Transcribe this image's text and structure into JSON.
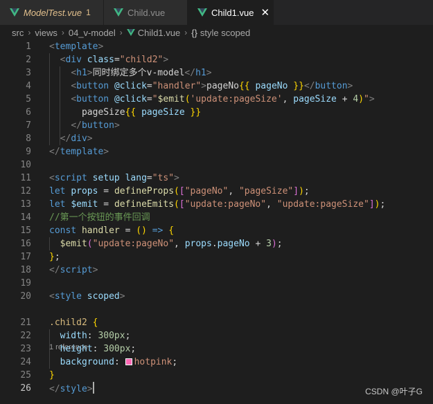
{
  "tabs": [
    {
      "label": "ModelTest.vue",
      "badge": "1",
      "state": "modified"
    },
    {
      "label": "Child.vue",
      "state": "inactive"
    },
    {
      "label": "Child1.vue",
      "state": "active"
    }
  ],
  "breadcrumb": {
    "segments": [
      "src",
      "views",
      "04_v-model",
      "Child1.vue"
    ],
    "symbol_icon": "{}",
    "symbol": "style scoped"
  },
  "editor": {
    "line_numbers": [
      "1",
      "2",
      "3",
      "4",
      "5",
      "6",
      "7",
      "8",
      "9",
      "10",
      "11",
      "12",
      "13",
      "14",
      "15",
      "16",
      "17",
      "18",
      "19",
      "20",
      "21",
      "22",
      "23",
      "24",
      "25",
      "26"
    ],
    "current_line": "26",
    "codelens": "1 reference",
    "lines": [
      [
        {
          "t": "<",
          "c": "t-br"
        },
        {
          "t": "template",
          "c": "t-tag"
        },
        {
          "t": ">",
          "c": "t-br"
        }
      ],
      [
        {
          "t": "  "
        },
        {
          "t": "<",
          "c": "t-br"
        },
        {
          "t": "div",
          "c": "t-tag"
        },
        {
          "t": " "
        },
        {
          "t": "class",
          "c": "t-attr"
        },
        {
          "t": "=",
          "c": "t-pun"
        },
        {
          "t": "\"child2\"",
          "c": "t-str"
        },
        {
          "t": ">",
          "c": "t-br"
        }
      ],
      [
        {
          "t": "    "
        },
        {
          "t": "<",
          "c": "t-br"
        },
        {
          "t": "h1",
          "c": "t-tag"
        },
        {
          "t": ">",
          "c": "t-br"
        },
        {
          "t": "同时绑定多个v-model",
          "c": "t-pun"
        },
        {
          "t": "</",
          "c": "t-br"
        },
        {
          "t": "h1",
          "c": "t-tag"
        },
        {
          "t": ">",
          "c": "t-br"
        }
      ],
      [
        {
          "t": "    "
        },
        {
          "t": "<",
          "c": "t-br"
        },
        {
          "t": "button",
          "c": "t-tag"
        },
        {
          "t": " "
        },
        {
          "t": "@click",
          "c": "t-attr"
        },
        {
          "t": "=",
          "c": "t-pun"
        },
        {
          "t": "\"handler\"",
          "c": "t-str"
        },
        {
          "t": ">",
          "c": "t-br"
        },
        {
          "t": "pageNo",
          "c": "t-pun"
        },
        {
          "t": "{{",
          "c": "t-b1"
        },
        {
          "t": " pageNo ",
          "c": "t-var"
        },
        {
          "t": "}}",
          "c": "t-b1"
        },
        {
          "t": "</",
          "c": "t-br"
        },
        {
          "t": "button",
          "c": "t-tag"
        },
        {
          "t": ">",
          "c": "t-br"
        }
      ],
      [
        {
          "t": "    "
        },
        {
          "t": "<",
          "c": "t-br"
        },
        {
          "t": "button",
          "c": "t-tag"
        },
        {
          "t": " "
        },
        {
          "t": "@click",
          "c": "t-attr"
        },
        {
          "t": "=",
          "c": "t-pun"
        },
        {
          "t": "\"",
          "c": "t-str"
        },
        {
          "t": "$emit",
          "c": "t-fn"
        },
        {
          "t": "(",
          "c": "t-b1"
        },
        {
          "t": "'update:pageSize'",
          "c": "t-str"
        },
        {
          "t": ", ",
          "c": "t-pun"
        },
        {
          "t": "pageSize",
          "c": "t-var"
        },
        {
          "t": " + ",
          "c": "t-pun"
        },
        {
          "t": "4",
          "c": "t-num"
        },
        {
          "t": ")",
          "c": "t-b1"
        },
        {
          "t": "\"",
          "c": "t-str"
        },
        {
          "t": ">",
          "c": "t-br"
        }
      ],
      [
        {
          "t": "      "
        },
        {
          "t": "pageSize",
          "c": "t-pun"
        },
        {
          "t": "{{",
          "c": "t-b1"
        },
        {
          "t": " pageSize ",
          "c": "t-var"
        },
        {
          "t": "}}",
          "c": "t-b1"
        }
      ],
      [
        {
          "t": "    "
        },
        {
          "t": "</",
          "c": "t-br"
        },
        {
          "t": "button",
          "c": "t-tag"
        },
        {
          "t": ">",
          "c": "t-br"
        }
      ],
      [
        {
          "t": "  "
        },
        {
          "t": "</",
          "c": "t-br"
        },
        {
          "t": "div",
          "c": "t-tag"
        },
        {
          "t": ">",
          "c": "t-br"
        }
      ],
      [
        {
          "t": "</",
          "c": "t-br"
        },
        {
          "t": "template",
          "c": "t-tag"
        },
        {
          "t": ">",
          "c": "t-br"
        }
      ],
      [],
      [
        {
          "t": "<",
          "c": "t-br"
        },
        {
          "t": "script",
          "c": "t-tag"
        },
        {
          "t": " "
        },
        {
          "t": "setup",
          "c": "t-attr"
        },
        {
          "t": " "
        },
        {
          "t": "lang",
          "c": "t-attr"
        },
        {
          "t": "=",
          "c": "t-pun"
        },
        {
          "t": "\"ts\"",
          "c": "t-str"
        },
        {
          "t": ">",
          "c": "t-br"
        }
      ],
      [
        {
          "t": "let",
          "c": "t-kw"
        },
        {
          "t": " "
        },
        {
          "t": "props",
          "c": "t-var"
        },
        {
          "t": " = ",
          "c": "t-pun"
        },
        {
          "t": "defineProps",
          "c": "t-fn"
        },
        {
          "t": "(",
          "c": "t-b1"
        },
        {
          "t": "[",
          "c": "t-b2"
        },
        {
          "t": "\"pageNo\"",
          "c": "t-str"
        },
        {
          "t": ", ",
          "c": "t-pun"
        },
        {
          "t": "\"pageSize\"",
          "c": "t-str"
        },
        {
          "t": "]",
          "c": "t-b2"
        },
        {
          "t": ")",
          "c": "t-b1"
        },
        {
          "t": ";",
          "c": "t-pun"
        }
      ],
      [
        {
          "t": "let",
          "c": "t-kw"
        },
        {
          "t": " "
        },
        {
          "t": "$emit",
          "c": "t-var"
        },
        {
          "t": " = ",
          "c": "t-pun"
        },
        {
          "t": "defineEmits",
          "c": "t-fn"
        },
        {
          "t": "(",
          "c": "t-b1"
        },
        {
          "t": "[",
          "c": "t-b2"
        },
        {
          "t": "\"update:pageNo\"",
          "c": "t-str"
        },
        {
          "t": ", ",
          "c": "t-pun"
        },
        {
          "t": "\"update:pageSize\"",
          "c": "t-str"
        },
        {
          "t": "]",
          "c": "t-b2"
        },
        {
          "t": ")",
          "c": "t-b1"
        },
        {
          "t": ";",
          "c": "t-pun"
        }
      ],
      [
        {
          "t": "//第一个按钮的事件回调",
          "c": "t-com"
        }
      ],
      [
        {
          "t": "const",
          "c": "t-kw"
        },
        {
          "t": " "
        },
        {
          "t": "handler",
          "c": "t-fn"
        },
        {
          "t": " = ",
          "c": "t-pun"
        },
        {
          "t": "()",
          "c": "t-b1"
        },
        {
          "t": " "
        },
        {
          "t": "=>",
          "c": "t-kw"
        },
        {
          "t": " "
        },
        {
          "t": "{",
          "c": "t-b1"
        }
      ],
      [
        {
          "t": "  "
        },
        {
          "t": "$emit",
          "c": "t-fn"
        },
        {
          "t": "(",
          "c": "t-b2"
        },
        {
          "t": "\"update:pageNo\"",
          "c": "t-str"
        },
        {
          "t": ", ",
          "c": "t-pun"
        },
        {
          "t": "props",
          "c": "t-var"
        },
        {
          "t": ".",
          "c": "t-pun"
        },
        {
          "t": "pageNo",
          "c": "t-var"
        },
        {
          "t": " + ",
          "c": "t-pun"
        },
        {
          "t": "3",
          "c": "t-num"
        },
        {
          "t": ")",
          "c": "t-b2"
        },
        {
          "t": ";",
          "c": "t-pun"
        }
      ],
      [
        {
          "t": "}",
          "c": "t-b1"
        },
        {
          "t": ";",
          "c": "t-pun"
        }
      ],
      [
        {
          "t": "</",
          "c": "t-br"
        },
        {
          "t": "script",
          "c": "t-tag"
        },
        {
          "t": ">",
          "c": "t-br"
        }
      ],
      [],
      [
        {
          "t": "<",
          "c": "t-br"
        },
        {
          "t": "style",
          "c": "t-tag"
        },
        {
          "t": " "
        },
        {
          "t": "scoped",
          "c": "t-attr"
        },
        {
          "t": ">",
          "c": "t-br"
        }
      ],
      [
        {
          "t": ".child2",
          "c": "t-sel"
        },
        {
          "t": " "
        },
        {
          "t": "{",
          "c": "t-b1"
        }
      ],
      [
        {
          "t": "  "
        },
        {
          "t": "width",
          "c": "t-prop"
        },
        {
          "t": ": ",
          "c": "t-pun"
        },
        {
          "t": "300px",
          "c": "t-num"
        },
        {
          "t": ";",
          "c": "t-pun"
        }
      ],
      [
        {
          "t": "  "
        },
        {
          "t": "height",
          "c": "t-prop"
        },
        {
          "t": ": ",
          "c": "t-pun"
        },
        {
          "t": "300px",
          "c": "t-num"
        },
        {
          "t": ";",
          "c": "t-pun"
        }
      ],
      [
        {
          "t": "  "
        },
        {
          "t": "background",
          "c": "t-prop"
        },
        {
          "t": ": ",
          "c": "t-pun"
        },
        {
          "swatch": "#ff69b4"
        },
        {
          "t": "hotpink",
          "c": "t-str"
        },
        {
          "t": ";",
          "c": "t-pun"
        }
      ],
      [
        {
          "t": "}",
          "c": "t-b1"
        }
      ],
      [
        {
          "t": "</",
          "c": "t-br"
        },
        {
          "t": "style",
          "c": "t-tag"
        },
        {
          "t": ">",
          "c": "t-br"
        },
        {
          "cursor": true
        }
      ]
    ]
  },
  "watermark": "CSDN @叶子G",
  "colors": {
    "editor_bg": "#1e1e1e",
    "tabbar_bg": "#252526",
    "vue_green": "#41b883",
    "modified": "#e2c08d"
  }
}
